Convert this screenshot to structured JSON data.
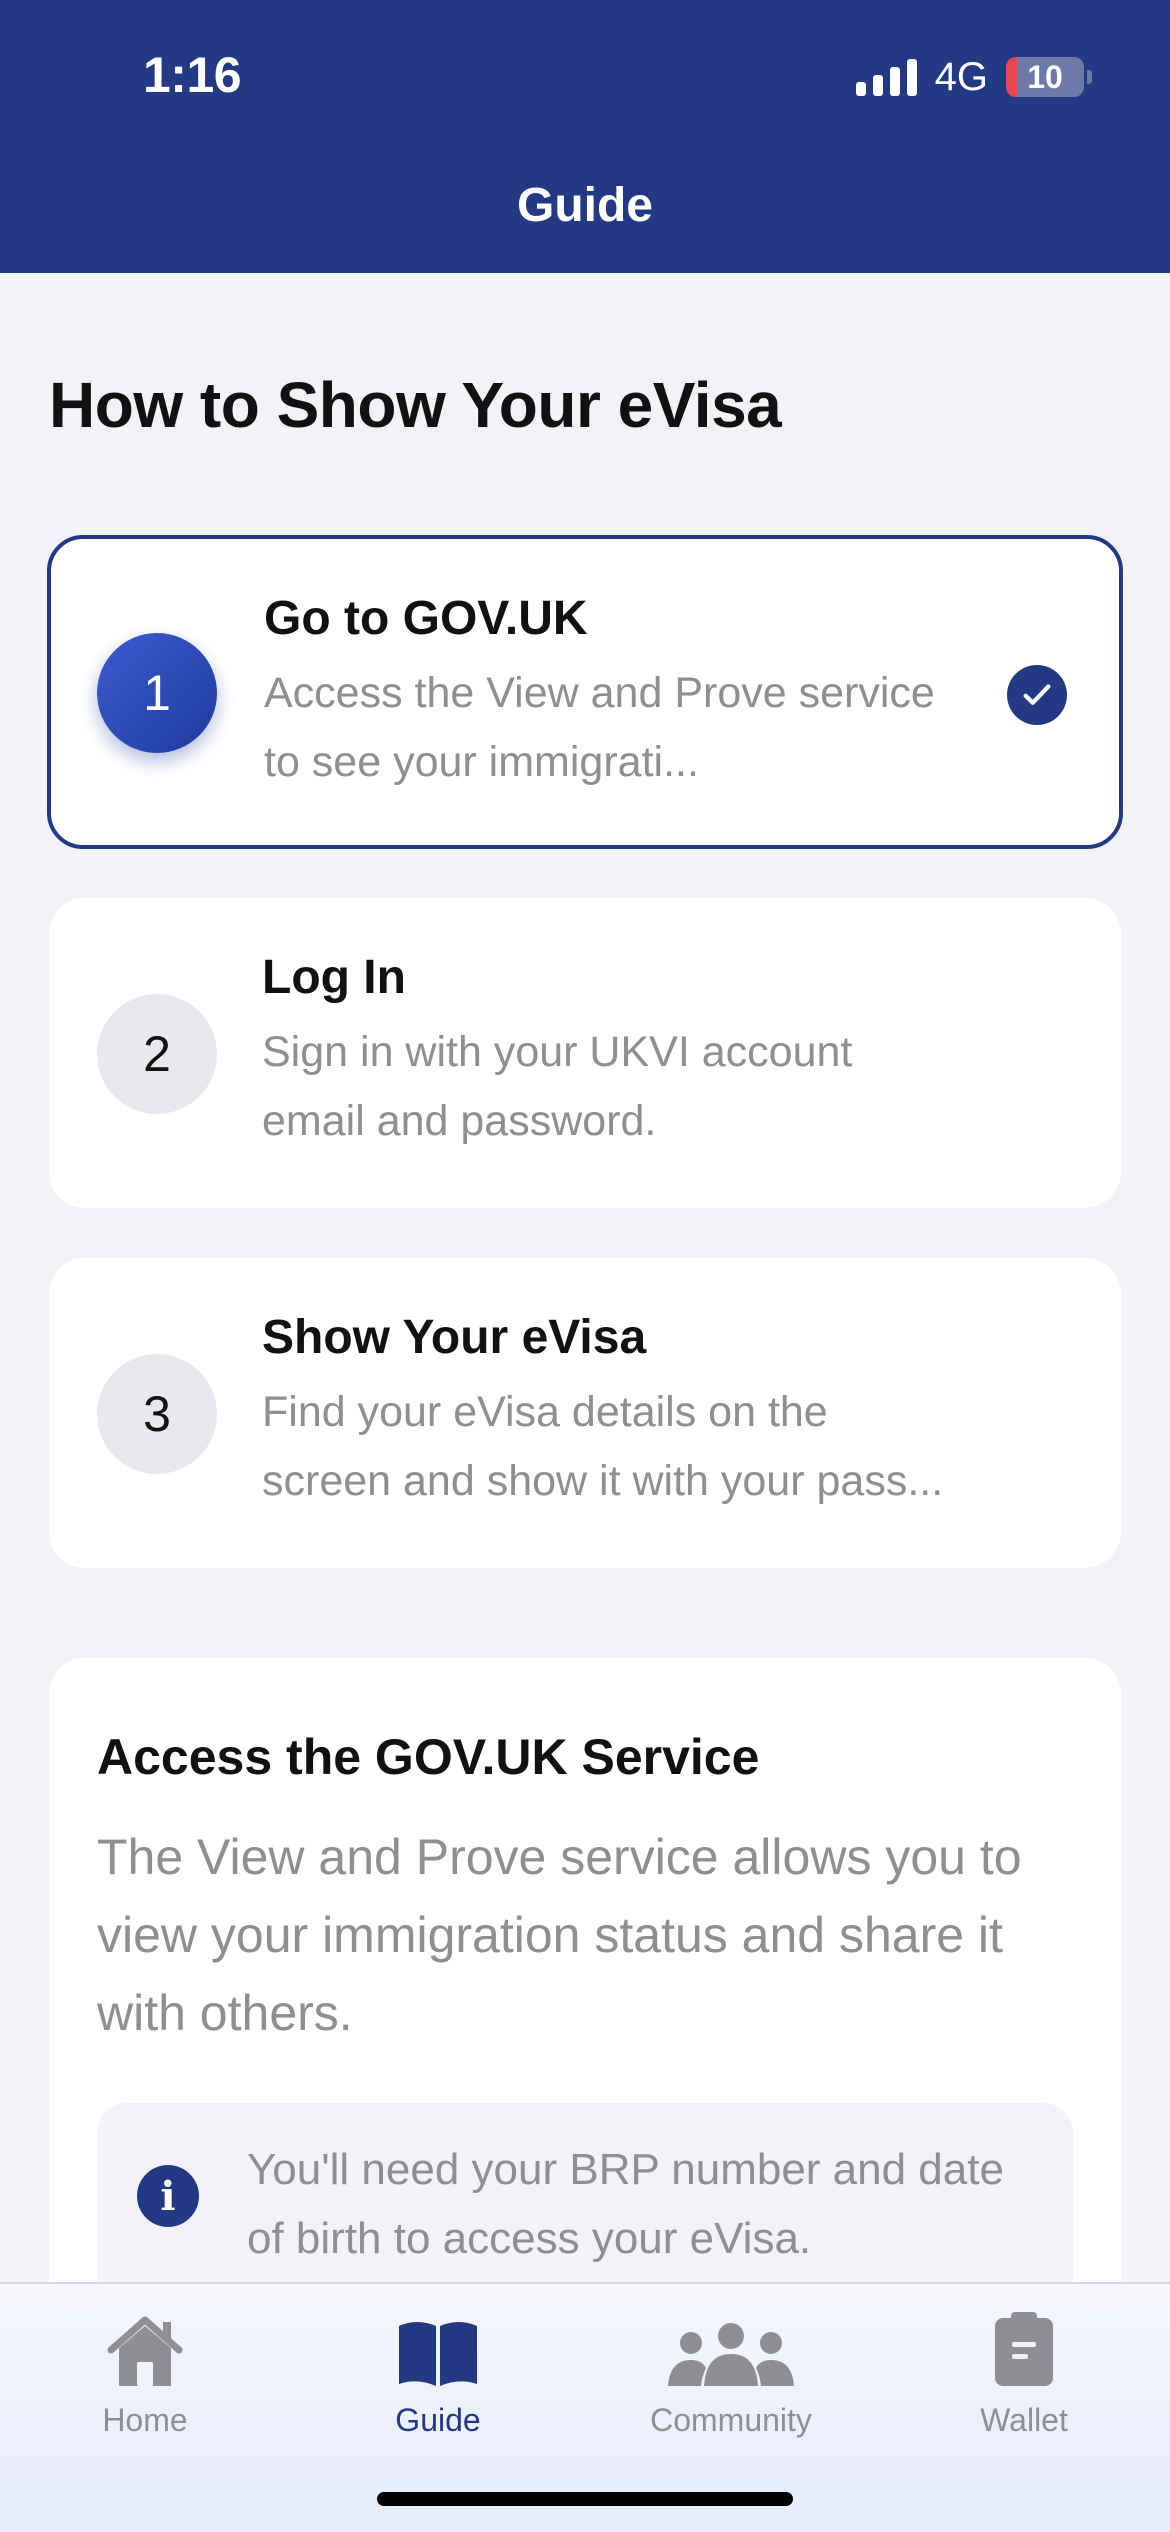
{
  "status_bar": {
    "time": "1:16",
    "network": "4G",
    "battery": "10"
  },
  "header": {
    "title": "Guide"
  },
  "page": {
    "title": "How to Show Your eVisa"
  },
  "steps": [
    {
      "number": "1",
      "title": "Go to GOV.UK",
      "description": "Access the View and Prove service to see your immigrati...",
      "completed": true
    },
    {
      "number": "2",
      "title": "Log In",
      "description": "Sign in with your UKVI account email and password.",
      "completed": false
    },
    {
      "number": "3",
      "title": "Show Your eVisa",
      "description": "Find your eVisa details on the screen and show it with your pass...",
      "completed": false
    }
  ],
  "info_card": {
    "title": "Access the GOV.UK Service",
    "body": "The View and Prove service allows you to view your immigration status and share it with others.",
    "note": "You'll need your BRP number and date of birth to access your eVisa."
  },
  "tabbar": {
    "items": [
      {
        "label": "Home",
        "icon": "home-icon",
        "active": false
      },
      {
        "label": "Guide",
        "icon": "book-icon",
        "active": true
      },
      {
        "label": "Community",
        "icon": "people-icon",
        "active": false
      },
      {
        "label": "Wallet",
        "icon": "wallet-icon",
        "active": false
      }
    ]
  },
  "colors": {
    "brand": "#243984",
    "muted": "#8e8e93",
    "background": "#f2f2f7"
  }
}
